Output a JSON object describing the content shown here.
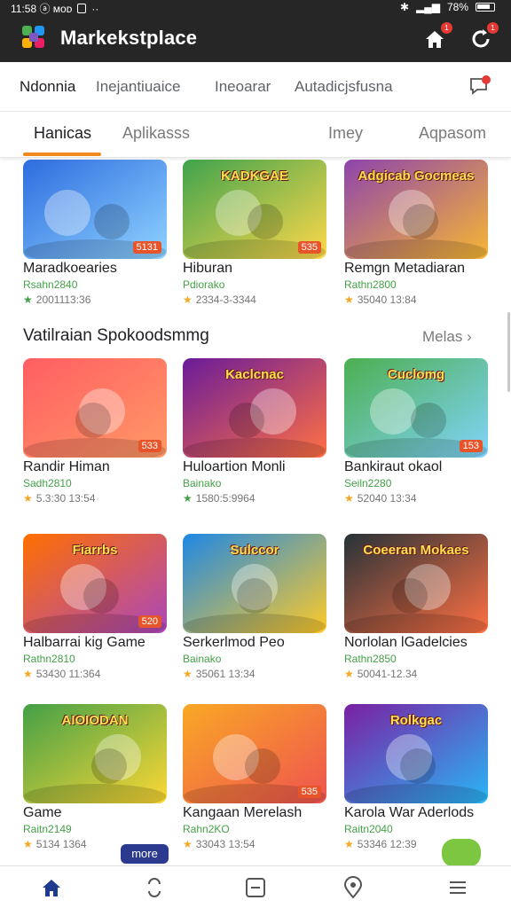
{
  "status_bar": {
    "time": "11:58 ⓐ ᴍᴏ⁠ᴅ",
    "battery": "78%"
  },
  "header": {
    "title": "Markekstplace",
    "home_badge": "1",
    "refresh_badge": "1"
  },
  "top_links": [
    "Ndonnia",
    "Inejantiuaice",
    "Ineoarar",
    "Autadicjsfusna"
  ],
  "message_badge": "1",
  "tabs": [
    {
      "label": "Hanicas",
      "active": true
    },
    {
      "label": "Aplikasss",
      "active": false
    },
    {
      "label": "Imey",
      "active": false
    },
    {
      "label": "Aqpasom",
      "active": false
    }
  ],
  "section": {
    "title": "Vatilraian Spokoodsmmg",
    "more": "Melas"
  },
  "cards": [
    {
      "name": "Maradkoearies",
      "dev": "Rsahn2840",
      "rating": "2001113:36",
      "star": "green",
      "thumb_text": "",
      "corner": "5131"
    },
    {
      "name": "Hiburan",
      "dev": "Pdiorako",
      "rating": "2334-3-3344",
      "star": "orange",
      "thumb_text": "KADKGAE",
      "corner": "535"
    },
    {
      "name": "Remgn Metadiaran",
      "dev": "Rathn2800",
      "rating": "35040 13:84",
      "star": "orange",
      "thumb_text": "Adgicab Gocmeas",
      "corner": ""
    },
    {
      "name": "Randir Himan",
      "dev": "Sadh2810",
      "rating": "5.3:30 13:54",
      "star": "orange",
      "thumb_text": "",
      "corner": "533"
    },
    {
      "name": "Huloartion Monli",
      "dev": "Bainako",
      "rating": "1580:5:9964",
      "star": "green",
      "thumb_text": "Kaclcnac",
      "corner": ""
    },
    {
      "name": "Bankiraut okaol",
      "dev": "Seiln2280",
      "rating": "52040 13:34",
      "star": "orange",
      "thumb_text": "Cuclomg",
      "corner": "153"
    },
    {
      "name": "Halbarrai kig Game",
      "dev": "Rathn2810",
      "rating": "53430 11:364",
      "star": "orange",
      "thumb_text": "Fiarrbs",
      "corner": "520"
    },
    {
      "name": "Serkerlmod Peo",
      "dev": "Bainako",
      "rating": "35061 13:34",
      "star": "orange",
      "thumb_text": "Sulccor",
      "corner": ""
    },
    {
      "name": "Norlolan lGadelcies",
      "dev": "Rathn2850",
      "rating": "50041-12.34",
      "star": "orange",
      "thumb_text": "Coeeran Mokaes",
      "corner": ""
    },
    {
      "name": "Game",
      "dev": "Raitn2149",
      "rating": "5134 1364",
      "star": "orange",
      "thumb_text": "AIOIODAN",
      "corner": ""
    },
    {
      "name": "Kangaan Merelash",
      "dev": "Rahn2KO",
      "rating": "33043 13:54",
      "star": "orange",
      "thumb_text": "",
      "corner": "535"
    },
    {
      "name": "Karola War Aderlods",
      "dev": "Raitn2040",
      "rating": "53346 12:39",
      "star": "orange",
      "thumb_text": "Rolkgac",
      "corner": ""
    }
  ],
  "chip_more": "more",
  "colors": {
    "accent": "#f08a1c",
    "appbar": "#262626",
    "dev_text": "#43a047"
  },
  "bottom_nav": [
    "home-icon",
    "swap-icon",
    "apps-icon",
    "location-icon",
    "menu-icon"
  ]
}
